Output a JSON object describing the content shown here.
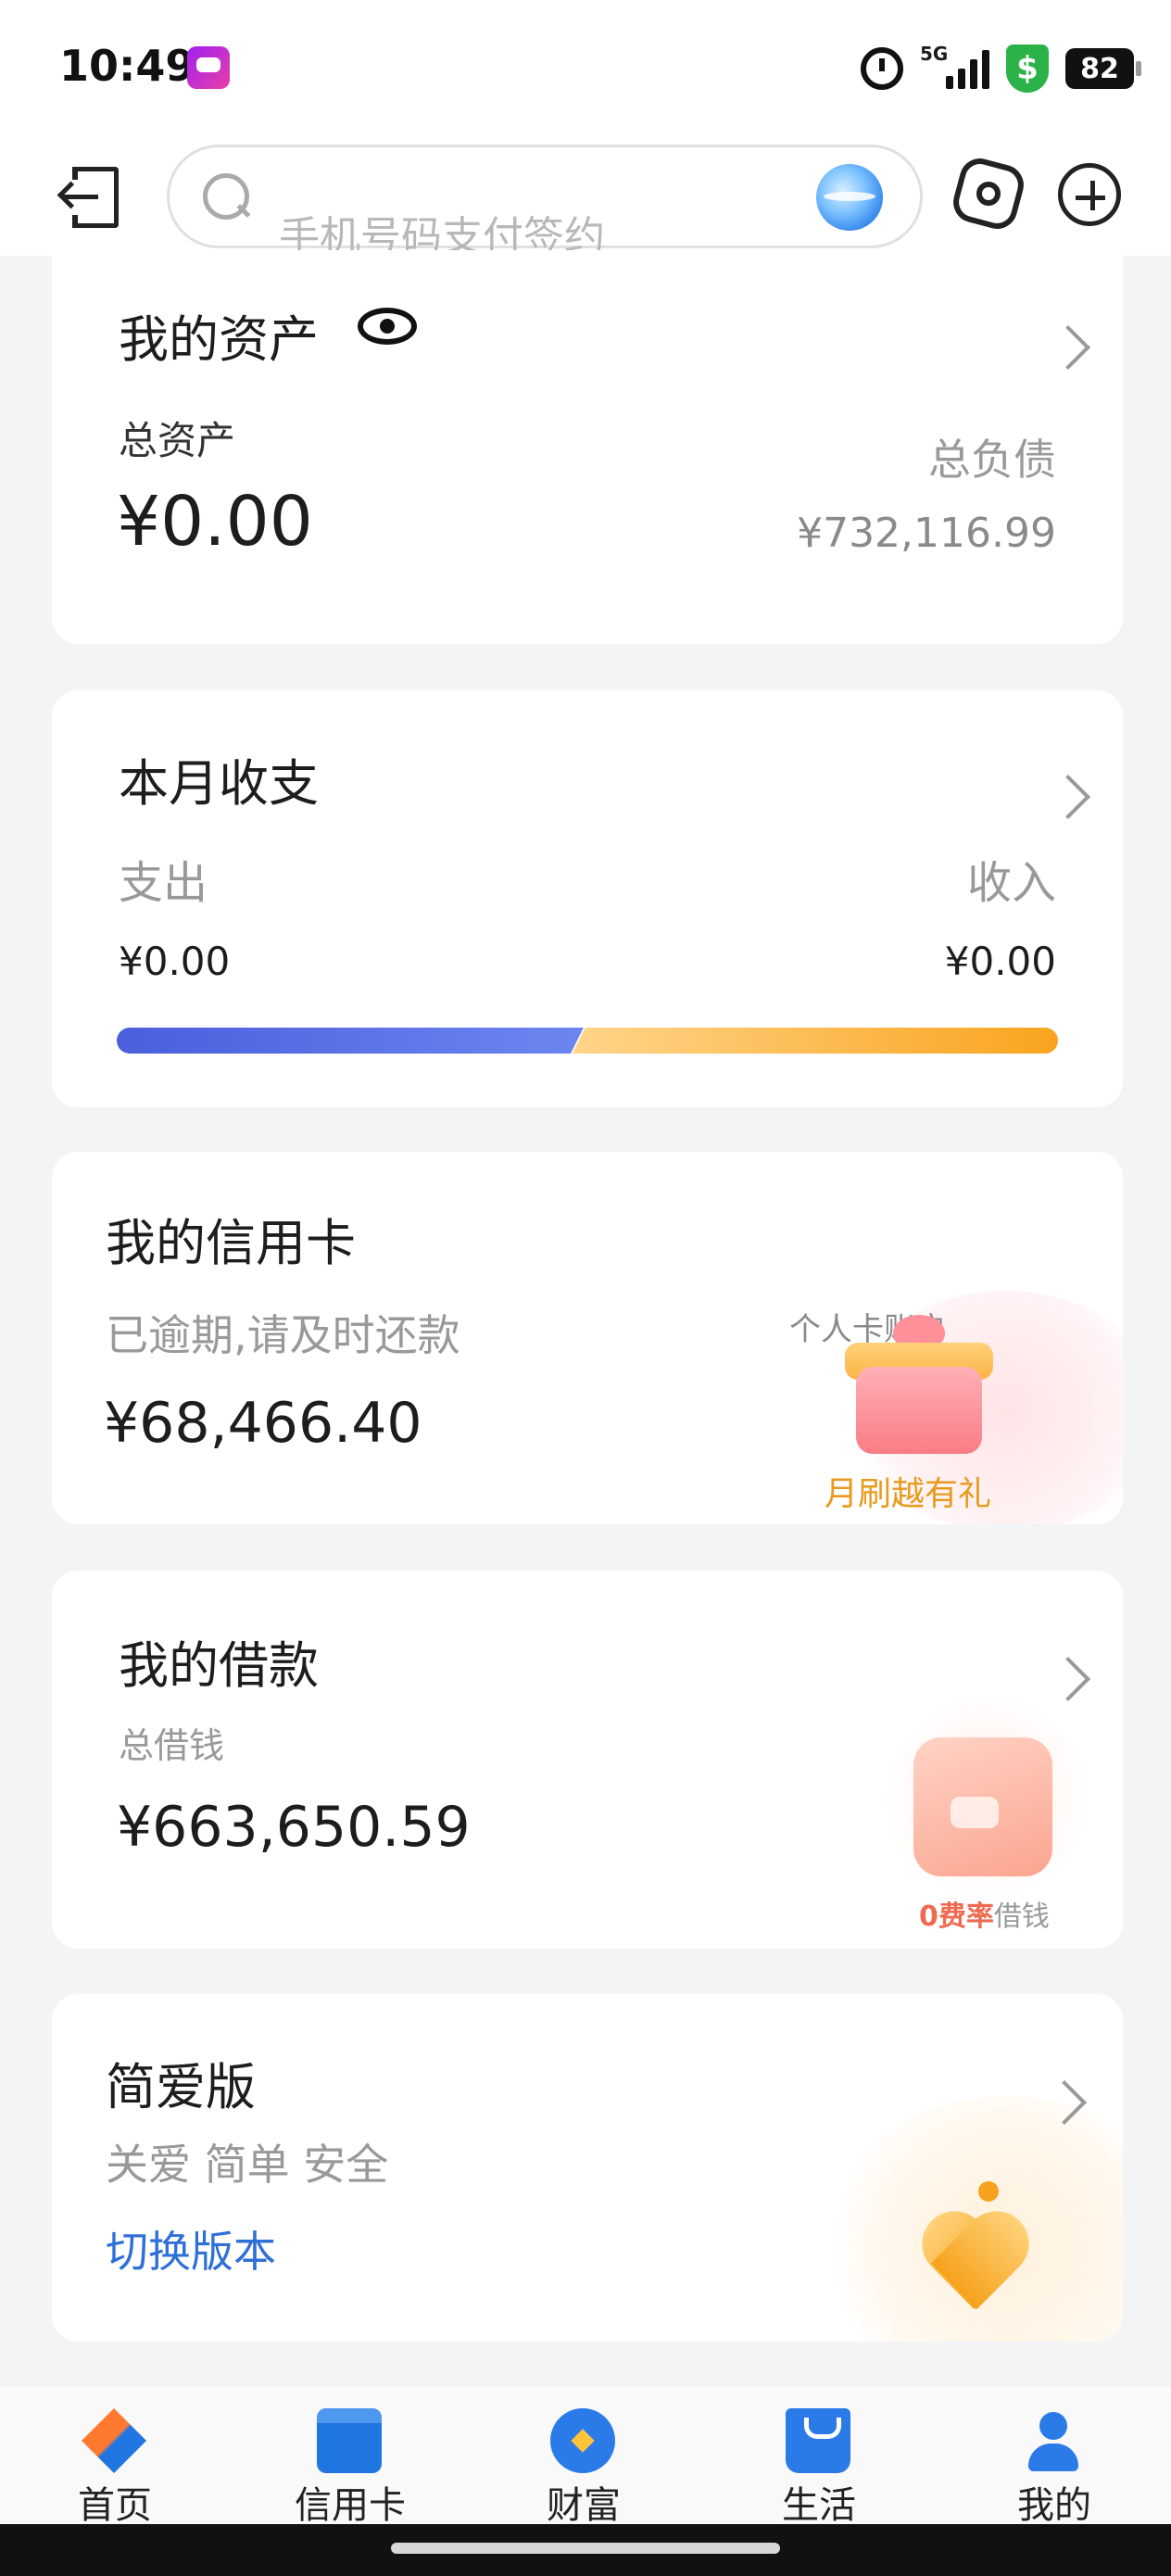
{
  "status_bar": {
    "time": "10:49",
    "network": "5G",
    "battery": "82",
    "shield_symbol": "$"
  },
  "top_nav": {
    "search_placeholder": "手机号码支付签约"
  },
  "assets": {
    "title": "我的资产",
    "total_assets_label": "总资产",
    "total_assets_value": "¥0.00",
    "total_liabilities_label": "总负债",
    "total_liabilities_value": "¥732,116.99"
  },
  "month": {
    "title": "本月收支",
    "expense_label": "支出",
    "expense_value": "¥0.00",
    "income_label": "收入",
    "income_value": "¥0.00",
    "expense_share": 0.49
  },
  "credit_card": {
    "title": "我的信用卡",
    "status_text": "已逾期,请及时还款",
    "amount": "¥68,466.40",
    "account_label": "个人卡账户",
    "promo": "月刷越有礼"
  },
  "loan": {
    "title": "我的借款",
    "total_label": "总借钱",
    "amount": "¥663,650.59",
    "promo_highlight": "0费率",
    "promo_rest": "借钱"
  },
  "simple": {
    "title": "简爱版",
    "subtitle": "关爱 简单 安全",
    "switch_link": "切换版本"
  },
  "bottom_nav": {
    "items": [
      {
        "label": "首页",
        "icon": "home-icon"
      },
      {
        "label": "信用卡",
        "icon": "credit-card-icon"
      },
      {
        "label": "财富",
        "icon": "wealth-icon"
      },
      {
        "label": "生活",
        "icon": "life-bag-icon"
      },
      {
        "label": "我的",
        "icon": "person-icon"
      }
    ]
  },
  "colors": {
    "expense_bar": "#4a5fdc",
    "income_bar": "#f9a41e",
    "link": "#2f6fd8",
    "promo": "#e89a1c",
    "loan_promo": "#ee6a50"
  }
}
